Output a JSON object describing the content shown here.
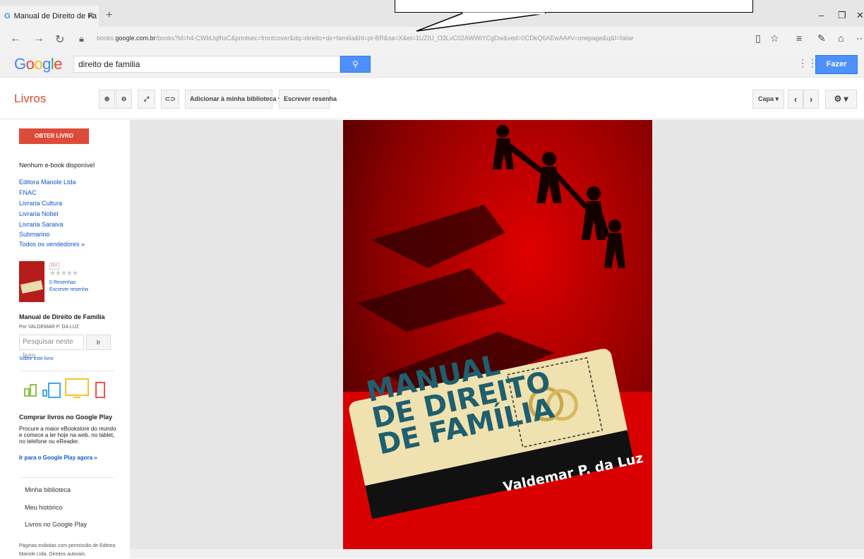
{
  "browser": {
    "tab_title": "Manual de Direito de Fa",
    "tab_icon": "G",
    "new_tab": "+",
    "url_prefix": "books.",
    "url_domain": "google.com.br",
    "url_rest": "/books?id=h4-CWbUqfhsC&printsec=frontcover&dq=direito+de+familia&hl=pt-BR&sa=X&ei=1UZIU_O3LvC02AWWiYCgDw&ved=0CDkQ6AEwAA#v=onepage&q&f=false"
  },
  "google": {
    "logo": "Google",
    "search_value": "direito de familia",
    "login_label": "Fazer login"
  },
  "toolbar": {
    "section": "Livros",
    "add_library": "Adicionar à minha biblioteca",
    "write_review": "Escrever resenha",
    "view_mode": "Capa"
  },
  "sidebar": {
    "buy_button": "OBTER LIVRO IMPRESSO",
    "no_ebook": "Nenhum e-book disponível",
    "sellers": [
      "Editora Manole Ltda",
      "FNAC",
      "Livraria Cultura",
      "Livraria Nobel",
      "Livraria Saraiva",
      "Submarino",
      "Todos os vendedores »"
    ],
    "reviews_count": "0 Resenhas",
    "write_review": "Escrever resenha",
    "book_title": "Manual de Direito de Família",
    "book_author": "Por VALDEMAR P. DA LUZ",
    "search_placeholder": "Pesquisar neste livro",
    "search_go": "Ir",
    "about": "Sobre este livro",
    "play_heading": "Comprar livros no Google Play",
    "play_desc": "Procure a maior eBookstore do mundo e comece a ler hoje na web, no tablet, no telefone ou eReader.",
    "play_link": "Ir para o Google Play agora »",
    "menu": [
      "Minha biblioteca",
      "Meu histórico",
      "Livros no Google Play"
    ],
    "footer": "Páginas exibidas com permissão de Editora Manole Ltda. Direitos autorais."
  },
  "cover": {
    "title_lines": [
      "MANUAL",
      "DE DIREITO",
      "DE FAMÍLIA"
    ],
    "author": "Valdemar P. da Luz"
  },
  "colors": {
    "accent_red": "#dd4b39",
    "link_blue": "#1155cc",
    "button_blue": "#4d90fe",
    "cover_red": "#c40000",
    "title_teal": "#1f5f6e"
  }
}
